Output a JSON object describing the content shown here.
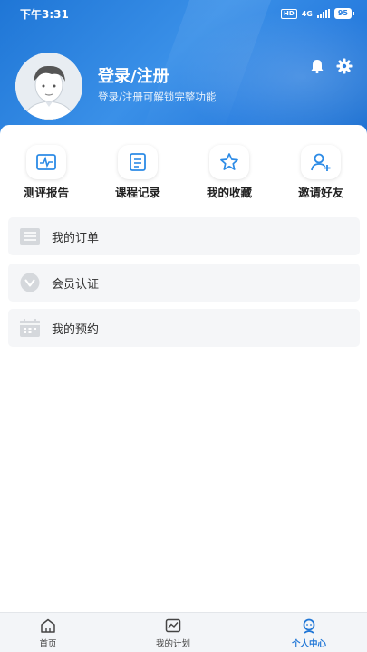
{
  "status_bar": {
    "time": "下午3:31",
    "network": "4G",
    "hd": "HD",
    "battery": "95"
  },
  "profile": {
    "title": "登录/注册",
    "subtitle": "登录/注册可解锁完整功能"
  },
  "quick_actions": [
    {
      "label": "测评报告",
      "icon": "report-chart-icon"
    },
    {
      "label": "课程记录",
      "icon": "course-record-icon"
    },
    {
      "label": "我的收藏",
      "icon": "star-icon"
    },
    {
      "label": "邀请好友",
      "icon": "invite-user-icon"
    }
  ],
  "menu": [
    {
      "label": "我的订单",
      "icon": "order-list-icon"
    },
    {
      "label": "会员认证",
      "icon": "vip-badge-icon"
    },
    {
      "label": "我的预约",
      "icon": "calendar-icon"
    }
  ],
  "tabs": [
    {
      "label": "首页",
      "icon": "home-icon"
    },
    {
      "label": "我的计划",
      "icon": "plan-chart-icon"
    },
    {
      "label": "个人中心",
      "icon": "profile-icon",
      "active": true
    }
  ],
  "colors": {
    "primary": "#1f76d6",
    "icon_blue": "#2c8be6"
  }
}
